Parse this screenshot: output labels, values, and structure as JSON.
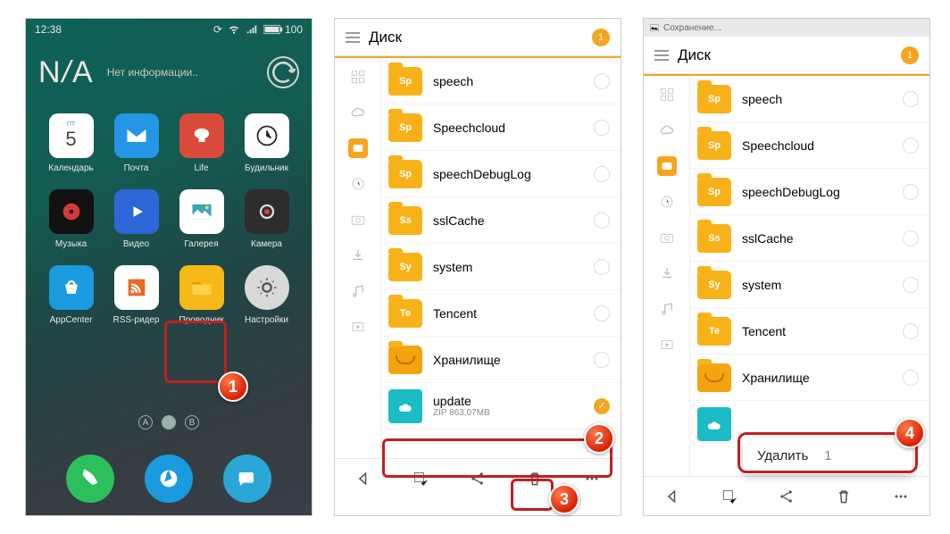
{
  "phone1": {
    "statusbar": {
      "time": "12:38",
      "battery": "100"
    },
    "na_big": "N/A",
    "na_text": "Нет информации..",
    "apps": [
      {
        "label": "Календарь",
        "icon": "calendar",
        "weekday": "ПТ",
        "day": "5"
      },
      {
        "label": "Почта",
        "icon": "mail"
      },
      {
        "label": "Life",
        "icon": "life"
      },
      {
        "label": "Будильник",
        "icon": "clock"
      },
      {
        "label": "Музыка",
        "icon": "music"
      },
      {
        "label": "Видео",
        "icon": "video"
      },
      {
        "label": "Галерея",
        "icon": "gallery"
      },
      {
        "label": "Камера",
        "icon": "camera"
      },
      {
        "label": "AppCenter",
        "icon": "appcenter"
      },
      {
        "label": "RSS-ридер",
        "icon": "rss"
      },
      {
        "label": "Проводник",
        "icon": "filemgr"
      },
      {
        "label": "Настройки",
        "icon": "settings"
      }
    ],
    "page_dots": [
      "A",
      "",
      "B"
    ],
    "dock": [
      "phone",
      "browser",
      "messages"
    ]
  },
  "fm": {
    "saving_text": "Сохранение...",
    "title": "Диск",
    "badge": "1",
    "items": [
      {
        "name": "speech",
        "tag": "Sp"
      },
      {
        "name": "Speechcloud",
        "tag": "Sp"
      },
      {
        "name": "speechDebugLog",
        "tag": "Sp"
      },
      {
        "name": "sslCache",
        "tag": "Ss"
      },
      {
        "name": "system",
        "tag": "Sy"
      },
      {
        "name": "Tencent",
        "tag": "Te"
      },
      {
        "name": "Хранилище",
        "tag": ""
      }
    ],
    "file": {
      "name": "update",
      "sub": "ZIP 863,07MB"
    },
    "delete_popup": {
      "label": "Удалить",
      "count": "1"
    }
  },
  "callouts": {
    "1": "1",
    "2": "2",
    "3": "3",
    "4": "4"
  }
}
